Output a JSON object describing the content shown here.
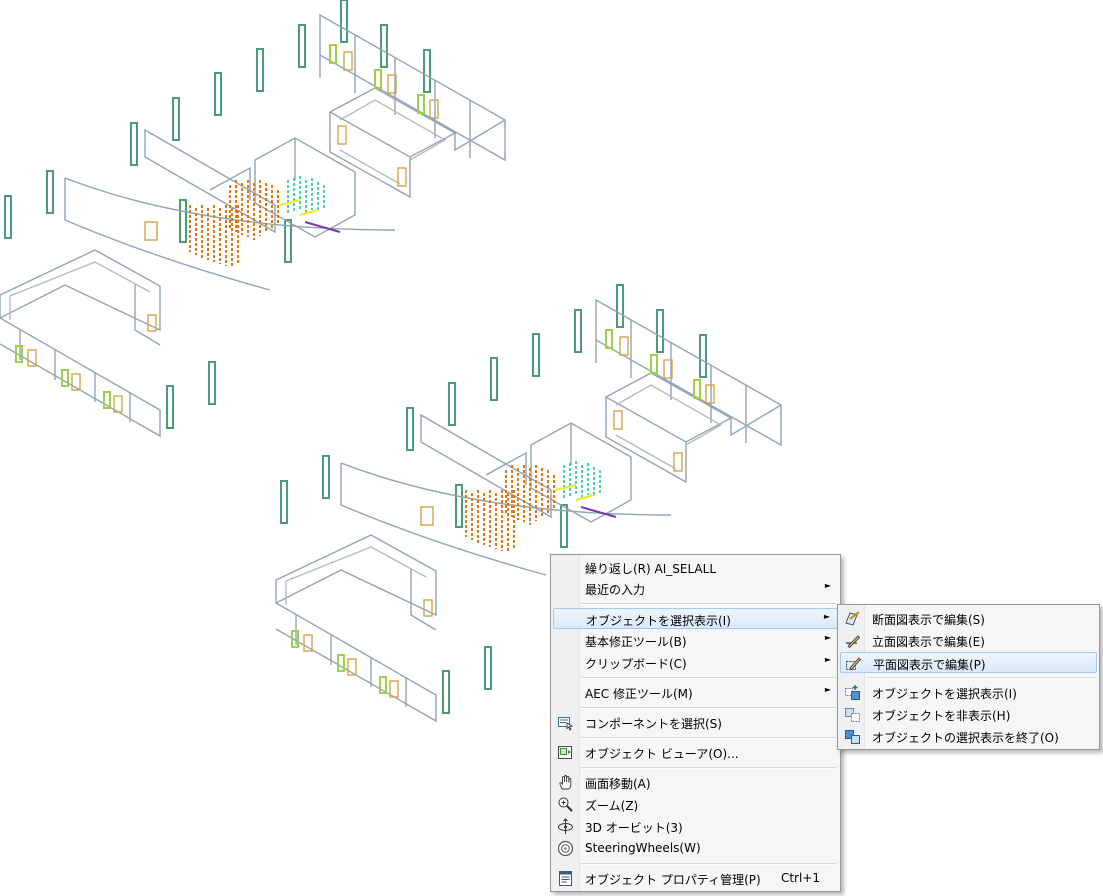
{
  "context_menu": {
    "items": [
      {
        "label": "繰り返し(R) AI_SELALL"
      },
      {
        "label": "最近の入力",
        "arrow": "►"
      },
      {
        "label": "オブジェクトを選択表示(I)",
        "arrow": "►"
      },
      {
        "label": "基本修正ツール(B)",
        "arrow": "►"
      },
      {
        "label": "クリップボード(C)",
        "arrow": "►"
      },
      {
        "label": "AEC 修正ツール(M)",
        "arrow": "►"
      },
      {
        "label": "コンポーネントを選択(S)",
        "icon": "component-select-icon"
      },
      {
        "label": "オブジェクト ビューア(O)...",
        "icon": "object-viewer-icon"
      },
      {
        "label": "画面移動(A)",
        "icon": "pan-hand-icon"
      },
      {
        "label": "ズーム(Z)",
        "icon": "zoom-icon"
      },
      {
        "label": "3D オービット(3)",
        "icon": "orbit-icon"
      },
      {
        "label": "SteeringWheels(W)",
        "icon": "steering-wheel-icon"
      },
      {
        "label": "オブジェクト プロパティ管理(P)",
        "shortcut": "Ctrl+1",
        "icon": "properties-icon"
      }
    ]
  },
  "isolate_submenu": {
    "items": [
      {
        "label": "断面図表示で編集(S)",
        "icon": "section-edit-icon"
      },
      {
        "label": "立面図表示で編集(E)",
        "icon": "elevation-edit-icon"
      },
      {
        "label": "平面図表示で編集(P)",
        "icon": "plan-edit-icon"
      },
      {
        "label": "オブジェクトを選択表示(I)",
        "icon": "isolate-objects-icon"
      },
      {
        "label": "オブジェクトを非表示(H)",
        "icon": "hide-objects-icon"
      },
      {
        "label": "オブジェクトの選択表示を終了(O)",
        "icon": "end-isolation-icon"
      }
    ]
  },
  "colors": {
    "wall": "#8fa4b8",
    "wall_gray": "#b9b9b9",
    "column": "#4e9a78",
    "door": "#d6a24d",
    "window": "#9fd04a",
    "furniture": "#e07a10",
    "teal": "#21c79a",
    "menu_bg": "#f5f6f7",
    "highlight": "#dbe9fa"
  }
}
